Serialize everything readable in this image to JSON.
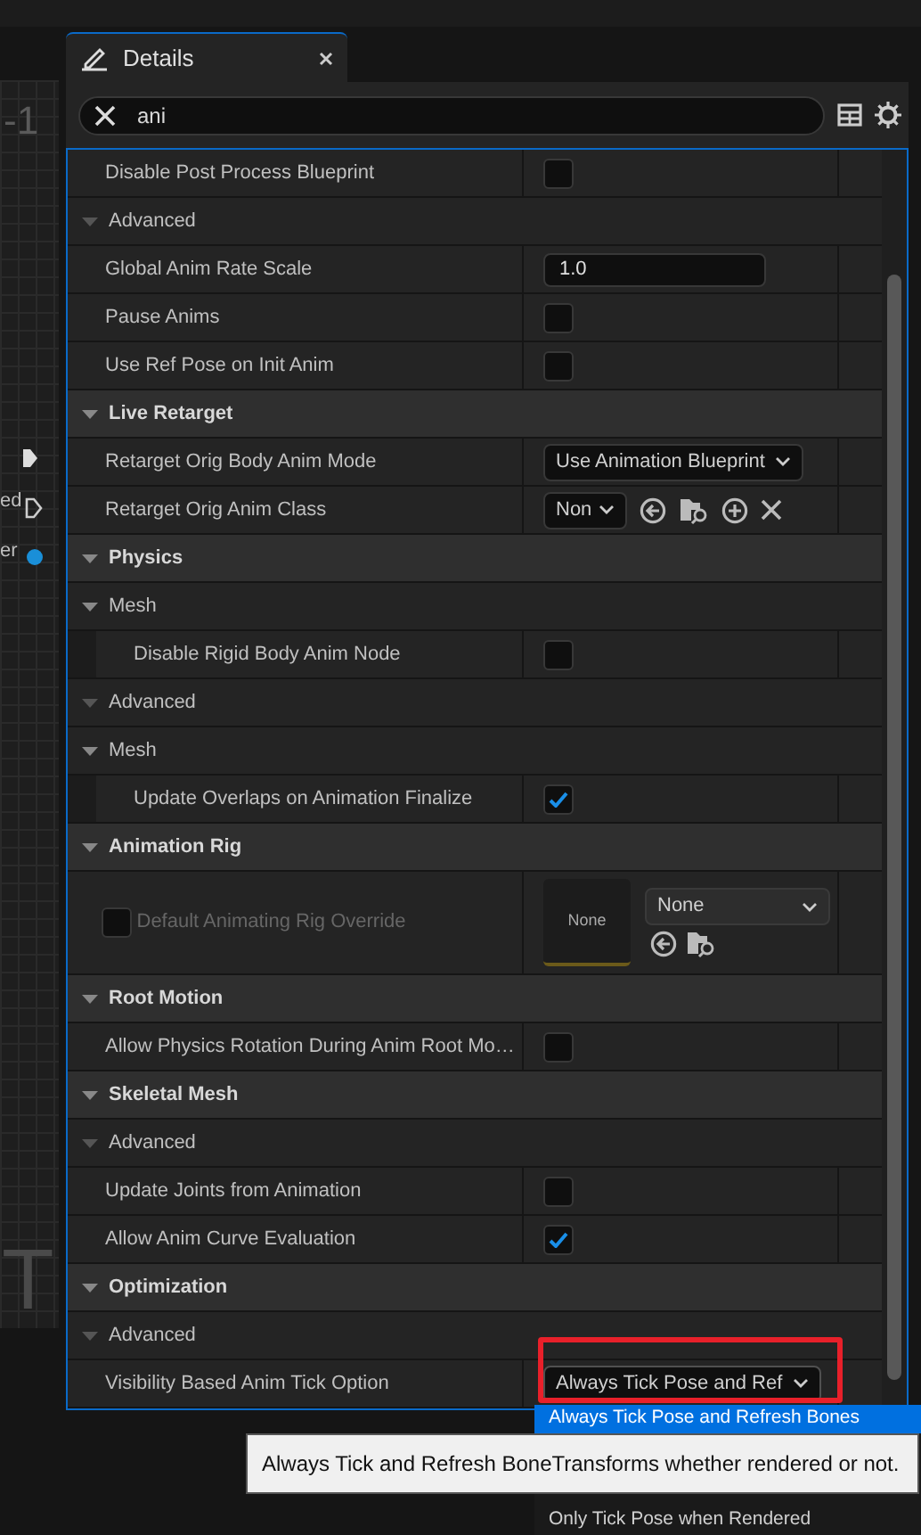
{
  "graph": {
    "labels": [
      {
        "text": "-1"
      },
      {
        "text": "ed"
      },
      {
        "text": "er"
      },
      {
        "text": "T"
      }
    ]
  },
  "tab": {
    "title": "Details",
    "selected": true
  },
  "search": {
    "value": "ani"
  },
  "rows": [
    {
      "kind": "property",
      "label": "Disable Post Process Blueprint",
      "control": {
        "kind": "checkbox",
        "checked": false
      }
    },
    {
      "kind": "advanced",
      "label": "Advanced",
      "expanded": true
    },
    {
      "kind": "property",
      "label": "Global Anim Rate Scale",
      "control": {
        "kind": "number",
        "value": "1.0"
      }
    },
    {
      "kind": "property",
      "label": "Pause Anims",
      "control": {
        "kind": "checkbox",
        "checked": false
      }
    },
    {
      "kind": "property",
      "label": "Use Ref Pose on Init Anim",
      "control": {
        "kind": "checkbox",
        "checked": false
      }
    },
    {
      "kind": "category",
      "label": "Live Retarget",
      "expanded": true,
      "children": [
        {
          "kind": "property",
          "label": "Retarget Orig Body Anim Mode",
          "control": {
            "kind": "combo",
            "value": "Use Animation Blueprint"
          }
        },
        {
          "kind": "property",
          "label": "Retarget Orig Anim Class",
          "control": {
            "kind": "class_picker",
            "value": "Non"
          }
        }
      ]
    },
    {
      "kind": "category",
      "label": "Physics",
      "expanded": true,
      "children": [
        {
          "kind": "subcategory",
          "label": "Mesh",
          "expanded": true,
          "children": [
            {
              "kind": "property",
              "label": "Disable Rigid Body Anim Node",
              "control": {
                "kind": "checkbox",
                "checked": false
              }
            }
          ]
        },
        {
          "kind": "advanced",
          "label": "Advanced",
          "expanded": true
        },
        {
          "kind": "subcategory",
          "label": "Mesh",
          "expanded": true,
          "children": [
            {
              "kind": "property",
              "label": "Update Overlaps on Animation Finalize",
              "control": {
                "kind": "checkbox",
                "checked": true
              }
            }
          ]
        }
      ]
    },
    {
      "kind": "category",
      "label": "Animation Rig",
      "expanded": true,
      "children": [
        {
          "kind": "property",
          "label": "Default Animating Rig Override",
          "disabled": true,
          "edit_condition": false,
          "control": {
            "kind": "asset_picker",
            "thumbnail": "None",
            "value": "None"
          }
        }
      ]
    },
    {
      "kind": "category",
      "label": "Root Motion",
      "expanded": true,
      "children": [
        {
          "kind": "property",
          "label": "Allow Physics Rotation During Anim Root Mo…",
          "control": {
            "kind": "checkbox",
            "checked": false
          }
        }
      ]
    },
    {
      "kind": "category",
      "label": "Skeletal Mesh",
      "expanded": true,
      "children": [
        {
          "kind": "advanced",
          "label": "Advanced",
          "expanded": true
        },
        {
          "kind": "property",
          "label": "Update Joints from Animation",
          "control": {
            "kind": "checkbox",
            "checked": false
          }
        },
        {
          "kind": "property",
          "label": "Allow Anim Curve Evaluation",
          "control": {
            "kind": "checkbox",
            "checked": true
          }
        }
      ]
    },
    {
      "kind": "category",
      "label": "Optimization",
      "expanded": true,
      "children": [
        {
          "kind": "advanced",
          "label": "Advanced",
          "expanded": true
        },
        {
          "kind": "property",
          "label": "Visibility Based Anim Tick Option",
          "control": {
            "kind": "combo",
            "value": "Always Tick Pose and Ref",
            "open": true,
            "highlighted": true
          }
        }
      ]
    }
  ],
  "dropdown": {
    "options": [
      {
        "label": "Always Tick Pose and Refresh Bones",
        "selected": true
      },
      {
        "label": "Only Tick Pose when Rendered",
        "selected": false
      }
    ]
  },
  "tooltip": {
    "text": "Always Tick and Refresh BoneTransforms whether rendered or not."
  }
}
